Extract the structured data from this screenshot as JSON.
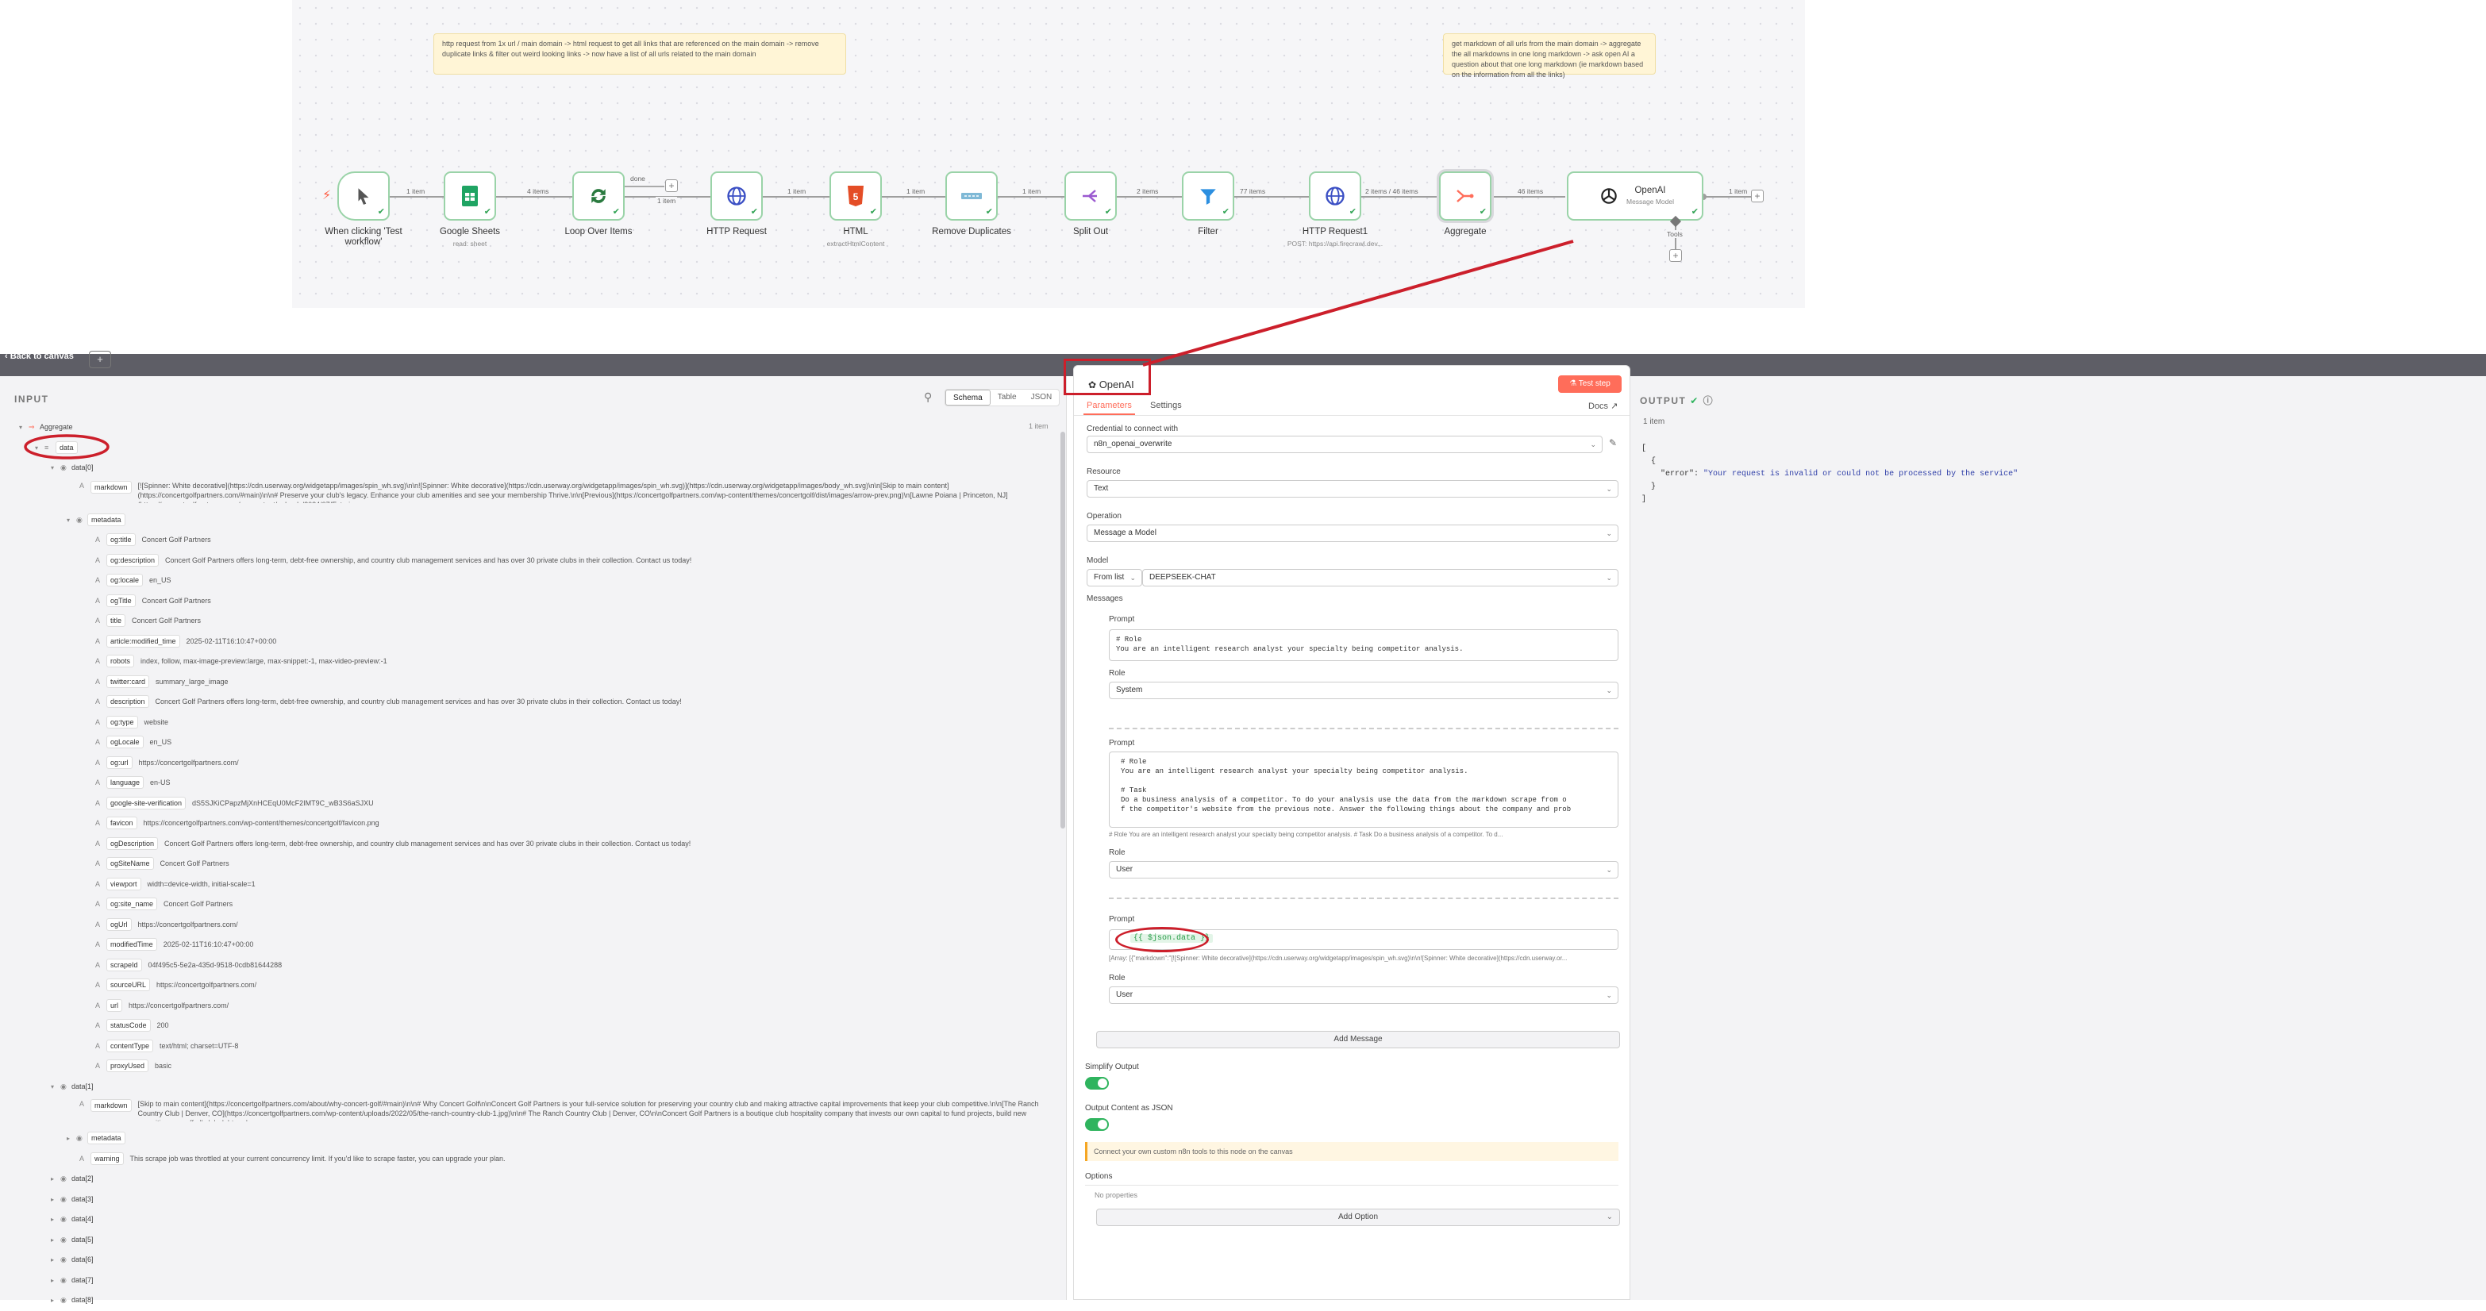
{
  "canvas": {
    "sticky_notes": [
      "http request from 1x url / main domain -> html request to get all links that are referenced on the main domain -> remove duplicate links & filter out weird looking links -> now have a list of all urls related to the main domain",
      "get markdown of all urls from the main domain -> aggregate the all markdowns in one long markdown -> ask open AI a question about that one long markdown (ie markdown based on the information from all the links)"
    ],
    "nodes": [
      {
        "label": "When clicking 'Test workflow'",
        "sub": "",
        "icon": "cursor-icon"
      },
      {
        "label": "Google Sheets",
        "sub": "read: sheet",
        "icon": "sheets-icon"
      },
      {
        "label": "Loop Over Items",
        "sub": "",
        "icon": "loop-icon"
      },
      {
        "label": "HTTP Request",
        "sub": "",
        "icon": "globe-icon"
      },
      {
        "label": "HTML",
        "sub": "extractHtmlContent",
        "icon": "html5-icon"
      },
      {
        "label": "Remove Duplicates",
        "sub": "",
        "icon": "duplicates-icon"
      },
      {
        "label": "Split Out",
        "sub": "",
        "icon": "split-icon"
      },
      {
        "label": "Filter",
        "sub": "",
        "icon": "filter-icon"
      },
      {
        "label": "HTTP Request1",
        "sub": "POST: https://api.firecrawl.dev...",
        "icon": "globe-icon"
      },
      {
        "label": "Aggregate",
        "sub": "",
        "icon": "aggregate-icon"
      }
    ],
    "openai_node": {
      "label": "OpenAI",
      "sub": "Message Model",
      "tools_label": "Tools"
    },
    "connection_labels": [
      "1 item",
      "4 items",
      "done",
      "1 item",
      "1 item",
      "1 item",
      "1 item",
      "2 items",
      "77 items",
      "2 items / 46 items",
      "46 items",
      "1 item",
      "1 item"
    ]
  },
  "topbar": {
    "back_label": "Back to canvas"
  },
  "input": {
    "heading": "INPUT",
    "view_tabs": [
      "Schema",
      "Table",
      "JSON"
    ],
    "item_count": "1 item",
    "tree": {
      "root": "Aggregate",
      "data": "data",
      "item0": "data[0]",
      "markdown0_key": "markdown",
      "markdown0_value": "[![Spinner: White decorative](https://cdn.userway.org/widgetapp/images/spin_wh.svg)\\n\\n![Spinner: White decorative](https://cdn.userway.org/widgetapp/images/spin_wh.svg)](https://cdn.userway.org/widgetapp/images/body_wh.svg)\\n\\n[Skip to main content](https://concertgolfpartners.com/#main)\\n\\n# Preserve your club's legacy. Enhance your club amenities and see your membership Thrive.\\n\\n[Previous](https://concertgolfpartners.com/wp-content/themes/concertgolf/dist/images/arrow-prev.png)\\n[Lawne Poiana | Princeton, NJ](https://concertgolfpartners.com/wp-content/uploads/2024/07/Exterio...",
      "metadata": "metadata",
      "metadata_rows": [
        {
          "k": "og:title",
          "v": "Concert Golf Partners"
        },
        {
          "k": "og:description",
          "v": "Concert Golf Partners offers long-term, debt-free ownership, and country club management services and has over 30 private clubs in their collection. Contact us today!"
        },
        {
          "k": "og:locale",
          "v": "en_US"
        },
        {
          "k": "ogTitle",
          "v": "Concert Golf Partners"
        },
        {
          "k": "title",
          "v": "Concert Golf Partners"
        },
        {
          "k": "article:modified_time",
          "v": "2025-02-11T16:10:47+00:00"
        },
        {
          "k": "robots",
          "v": "index, follow, max-image-preview:large, max-snippet:-1, max-video-preview:-1"
        },
        {
          "k": "twitter:card",
          "v": "summary_large_image"
        },
        {
          "k": "description",
          "v": "Concert Golf Partners offers long-term, debt-free ownership, and country club management services and has over 30 private clubs in their collection. Contact us today!"
        },
        {
          "k": "og:type",
          "v": "website"
        },
        {
          "k": "ogLocale",
          "v": "en_US"
        },
        {
          "k": "og:url",
          "v": "https://concertgolfpartners.com/"
        },
        {
          "k": "language",
          "v": "en-US"
        },
        {
          "k": "google-site-verification",
          "v": "dS5SJKiCPapzMjXnHCEqU0McF2IMT9C_wB3S6aSJXU"
        },
        {
          "k": "favicon",
          "v": "https://concertgolfpartners.com/wp-content/themes/concertgolf/favicon.png"
        },
        {
          "k": "ogDescription",
          "v": "Concert Golf Partners offers long-term, debt-free ownership, and country club management services and has over 30 private clubs in their collection. Contact us today!"
        },
        {
          "k": "ogSiteName",
          "v": "Concert Golf Partners"
        },
        {
          "k": "viewport",
          "v": "width=device-width, initial-scale=1"
        },
        {
          "k": "og:site_name",
          "v": "Concert Golf Partners"
        },
        {
          "k": "ogUrl",
          "v": "https://concertgolfpartners.com/"
        },
        {
          "k": "modifiedTime",
          "v": "2025-02-11T16:10:47+00:00"
        },
        {
          "k": "scrapeId",
          "v": "04f495c5-5e2a-435d-9518-0cdb81644288"
        },
        {
          "k": "sourceURL",
          "v": "https://concertgolfpartners.com/"
        },
        {
          "k": "url",
          "v": "https://concertgolfpartners.com/"
        },
        {
          "k": "statusCode",
          "v": "200"
        },
        {
          "k": "contentType",
          "v": "text/html; charset=UTF-8"
        },
        {
          "k": "proxyUsed",
          "v": "basic"
        }
      ],
      "item1": "data[1]",
      "markdown1_key": "markdown",
      "markdown1_value": "[Skip to main content](https://concertgolfpartners.com/about/why-concert-golf/#main)\\n\\n# Why Concert Golf\\n\\nConcert Golf Partners is your full-service solution for preserving your country club and making attractive capital improvements that keep your club competitive.\\n\\n[The Ranch Country Club | Denver, CO](https://concertgolfpartners.com/wp-content/uploads/2022/05/the-ranch-country-club-1.jpg)\\n\\n# The Ranch Country Club | Denver, CO\\n\\nConcert Golf Partners is a boutique club hospitality company that invests our own capital to fund projects, build new amenities, pay off all club debt and ensur...",
      "metadata1": "metadata",
      "warning_key": "warning",
      "warning_value": "This scrape job was throttled at your current concurrency limit. If you'd like to scrape faster, you can upgrade your plan.",
      "collapsed_items": [
        "data[2]",
        "data[3]",
        "data[4]",
        "data[5]",
        "data[6]",
        "data[7]",
        "data[8]"
      ]
    }
  },
  "params": {
    "node_title": "OpenAI",
    "test_step_label": "Test step",
    "tabs": [
      "Parameters",
      "Settings"
    ],
    "docs_label": "Docs",
    "credential_label": "Credential to connect with",
    "credential_value": "n8n_openai_overwrite",
    "resource_label": "Resource",
    "resource_value": "Text",
    "operation_label": "Operation",
    "operation_value": "Message a Model",
    "model_label": "Model",
    "model_mode": "From list",
    "model_value": "DEEPSEEK-CHAT",
    "messages_label": "Messages",
    "message1": {
      "prompt_label": "Prompt",
      "prompt_line1": "# Role",
      "prompt_line2": "You are an intelligent research analyst your specialty being competitor analysis.",
      "role_label": "Role",
      "role_value": "System"
    },
    "message2": {
      "prompt_label": "Prompt",
      "prompt_lines": [
        "# Role",
        "You are an intelligent research analyst your specialty being competitor analysis.",
        "",
        "# Task",
        "Do a business analysis of a competitor. To do your analysis use the data from the markdown scrape from o",
        "f the competitor's website from the previous note. Answer the following things about the company and prob"
      ],
      "preview": "# Role You are an intelligent research analyst your specialty being competitor analysis.  # Task Do a business analysis of a competitor. To d...",
      "role_label": "Role",
      "role_value": "User"
    },
    "message3": {
      "prompt_label": "Prompt",
      "expression": "{{ $json.data }}",
      "preview": "[Array: [{\"markdown\":\"[![Spinner: White decorative](https://cdn.userway.org/widgetapp/images/spin_wh.svg)\\n\\n![Spinner: White decorative](https://cdn.userway.or...",
      "role_label": "Role",
      "role_value": "User"
    },
    "add_message_label": "Add Message",
    "simplify_label": "Simplify Output",
    "json_label": "Output Content as JSON",
    "tools_notice": "Connect your own custom n8n tools to this node on the canvas",
    "options_label": "Options",
    "no_properties": "No properties",
    "add_option_label": "Add Option"
  },
  "output": {
    "heading": "OUTPUT",
    "item_count": "1 item",
    "json_lines": [
      "[",
      "  {",
      "    \"error\": \"Your request is invalid or could not be processed by the service\"",
      "  }",
      "]"
    ]
  },
  "colors": {
    "accent": "#ff6d5a",
    "success": "#2fb45e",
    "annotation": "#cc1f2b",
    "sticky": "#fff5d6"
  }
}
